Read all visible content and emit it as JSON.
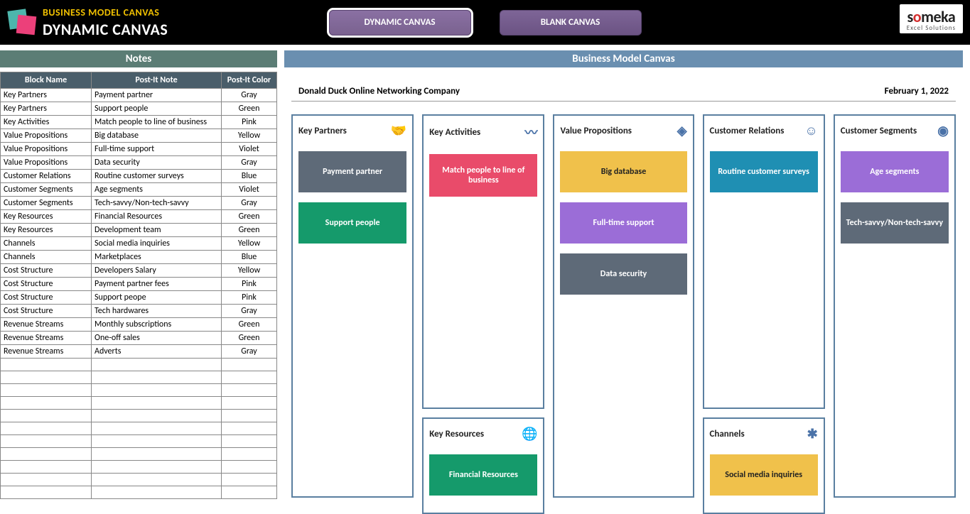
{
  "header": {
    "title1": "BUSINESS MODEL CANVAS",
    "title2": "DYNAMIC CANVAS",
    "tab_dynamic": "DYNAMIC CANVAS",
    "tab_blank": "BLANK CANVAS",
    "brand_name": "someka",
    "brand_sub": "Excel Solutions"
  },
  "bars": {
    "notes": "Notes",
    "canvas": "Business Model Canvas"
  },
  "notes_headers": {
    "c1": "Block Name",
    "c2": "Post-It Note",
    "c3": "Post-It Color"
  },
  "notes_rows": [
    {
      "b": "Key Partners",
      "n": "Payment partner",
      "c": "Gray"
    },
    {
      "b": "Key Partners",
      "n": "Support people",
      "c": "Green"
    },
    {
      "b": "Key Activities",
      "n": "Match people to line of business",
      "c": "Pink"
    },
    {
      "b": "Value Propositions",
      "n": "Big database",
      "c": "Yellow"
    },
    {
      "b": "Value Propositions",
      "n": "Full-time support",
      "c": "Violet"
    },
    {
      "b": "Value Propositions",
      "n": "Data security",
      "c": "Gray"
    },
    {
      "b": "Customer Relations",
      "n": "Routine customer surveys",
      "c": "Blue"
    },
    {
      "b": "Customer Segments",
      "n": "Age segments",
      "c": "Violet"
    },
    {
      "b": "Customer Segments",
      "n": "Tech-savvy/Non-tech-savvy",
      "c": "Gray"
    },
    {
      "b": "Key Resources",
      "n": "Financial Resources",
      "c": "Green"
    },
    {
      "b": "Key Resources",
      "n": "Development team",
      "c": "Green"
    },
    {
      "b": "Channels",
      "n": "Social media inquiries",
      "c": "Yellow"
    },
    {
      "b": "Channels",
      "n": "Marketplaces",
      "c": "Blue"
    },
    {
      "b": "Cost Structure",
      "n": "Developers Salary",
      "c": "Yellow"
    },
    {
      "b": "Cost Structure",
      "n": "Payment partner fees",
      "c": "Pink"
    },
    {
      "b": "Cost Structure",
      "n": "Support peope",
      "c": "Pink"
    },
    {
      "b": "Cost Structure",
      "n": "Tech hardwares",
      "c": "Gray"
    },
    {
      "b": "Revenue Streams",
      "n": "Monthly subscriptions",
      "c": "Green"
    },
    {
      "b": "Revenue Streams",
      "n": "One-off sales",
      "c": "Green"
    },
    {
      "b": "Revenue Streams",
      "n": "Adverts",
      "c": "Gray"
    }
  ],
  "canvas": {
    "company": "Donald Duck Online Networking Company",
    "date": "February 1, 2022",
    "blocks": {
      "key_partners": {
        "title": "Key Partners",
        "icon": "🤝",
        "notes": [
          {
            "t": "Payment partner",
            "c": "gray"
          },
          {
            "t": "Support people",
            "c": "green"
          }
        ]
      },
      "key_activities": {
        "title": "Key Activities",
        "icon": "〰",
        "notes": [
          {
            "t": "Match people to line of business",
            "c": "pink"
          }
        ]
      },
      "key_resources": {
        "title": "Key Resources",
        "icon": "🌐",
        "notes": [
          {
            "t": "Financial Resources",
            "c": "green"
          }
        ]
      },
      "value_propositions": {
        "title": "Value Propositions",
        "icon": "◈",
        "notes": [
          {
            "t": "Big database",
            "c": "yellow"
          },
          {
            "t": "Full-time support",
            "c": "violet"
          },
          {
            "t": "Data security",
            "c": "gray"
          }
        ]
      },
      "customer_relations": {
        "title": "Customer Relations",
        "icon": "☺",
        "notes": [
          {
            "t": "Routine customer surveys",
            "c": "blue"
          }
        ]
      },
      "channels": {
        "title": "Channels",
        "icon": "✱",
        "notes": [
          {
            "t": "Social media inquiries",
            "c": "yellow"
          }
        ]
      },
      "customer_segments": {
        "title": "Customer Segments",
        "icon": "◉",
        "notes": [
          {
            "t": "Age segments",
            "c": "violet"
          },
          {
            "t": "Tech-savvy/Non-tech-savvy",
            "c": "gray"
          }
        ]
      }
    }
  }
}
